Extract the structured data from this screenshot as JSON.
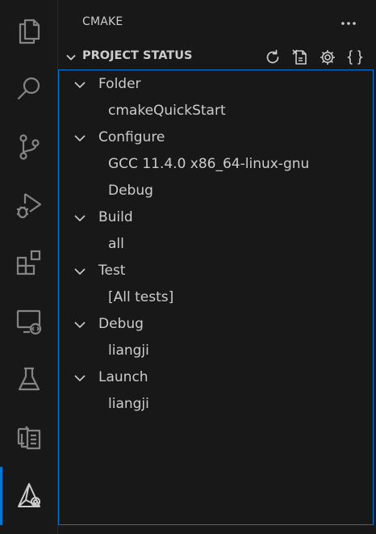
{
  "activity_bar": {
    "items": [
      {
        "name": "explorer-icon"
      },
      {
        "name": "search-icon"
      },
      {
        "name": "source-control-icon"
      },
      {
        "name": "run-debug-icon"
      },
      {
        "name": "extensions-icon"
      },
      {
        "name": "remote-explorer-icon"
      },
      {
        "name": "testing-icon"
      },
      {
        "name": "remote-server-icon"
      },
      {
        "name": "cmake-icon",
        "active": true
      }
    ],
    "accent": "#0078d4"
  },
  "sidebar": {
    "view_title": "CMAKE",
    "section": {
      "title": "PROJECT STATUS",
      "actions": [
        "refresh-icon",
        "delete-cache-icon",
        "settings-icon",
        "braces-icon"
      ]
    },
    "tree": [
      {
        "group": "Folder",
        "items": [
          "cmakeQuickStart"
        ]
      },
      {
        "group": "Configure",
        "items": [
          "GCC 11.4.0 x86_64-linux-gnu",
          "Debug"
        ]
      },
      {
        "group": "Build",
        "items": [
          "all"
        ]
      },
      {
        "group": "Test",
        "items": [
          "[All tests]"
        ]
      },
      {
        "group": "Debug",
        "items": [
          "liangji"
        ]
      },
      {
        "group": "Launch",
        "items": [
          "liangji"
        ]
      }
    ]
  }
}
